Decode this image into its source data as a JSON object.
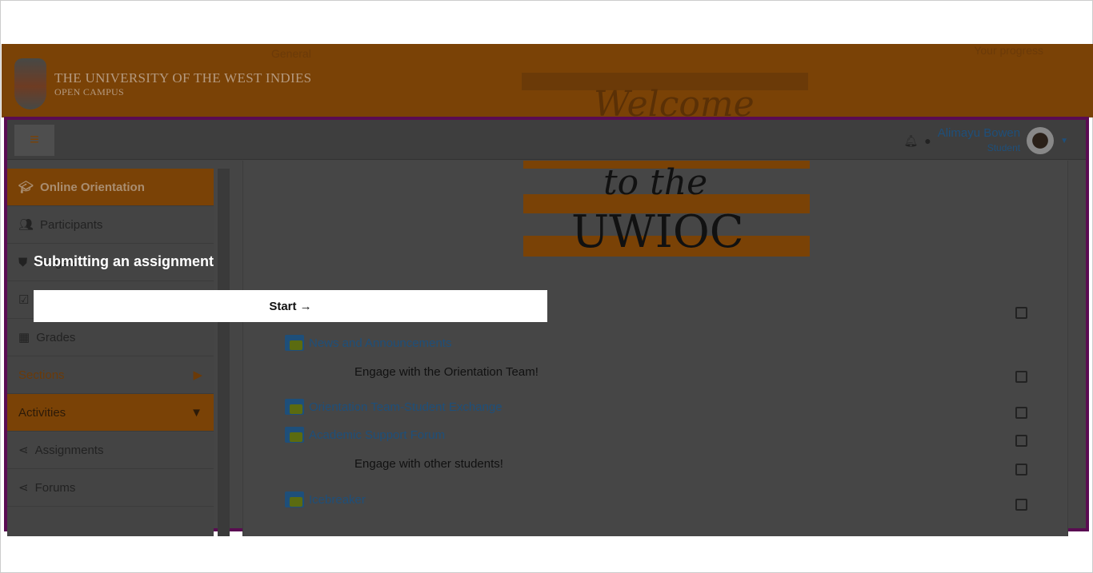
{
  "header": {
    "org_name": "THE UNIVERSITY OF THE WEST INDIES",
    "org_sub": "OPEN CAMPUS",
    "general_label": "General",
    "progress_label": "Your progress"
  },
  "user": {
    "name": "Alimayu Bowen",
    "role": "Student"
  },
  "sidebar": {
    "items": [
      {
        "label": "Online Orientation",
        "icon": "graduation-cap-icon"
      },
      {
        "label": "Participants",
        "icon": "users-icon"
      },
      {
        "label": "Badges",
        "icon": "shield-icon"
      },
      {
        "label": "",
        "icon": "checkbox-icon"
      },
      {
        "label": "Grades",
        "icon": "table-icon"
      },
      {
        "label": "Sections",
        "icon": "caret-right-icon"
      },
      {
        "label": "Activities",
        "icon": "caret-down-icon"
      },
      {
        "label": "Assignments",
        "icon": "share-icon"
      },
      {
        "label": "Forums",
        "icon": "share-icon"
      }
    ]
  },
  "content": {
    "items": [
      {
        "label": "News and Announcements",
        "type": "forum"
      },
      {
        "label": "Engage with the Orientation Team!",
        "type": "text"
      },
      {
        "label": "Orientation Team-Student Exchange",
        "type": "forum"
      },
      {
        "label": "Academic Support Forum",
        "type": "forum"
      },
      {
        "label": "Engage with other students!",
        "type": "text"
      },
      {
        "label": "Icebreaker",
        "type": "forum"
      }
    ]
  },
  "tour": {
    "title": "Submitting an assignment",
    "start_label": "Start →"
  },
  "colors": {
    "brand": "#f39c12",
    "frame": "#8b1a82",
    "link": "#2a7fc1"
  }
}
